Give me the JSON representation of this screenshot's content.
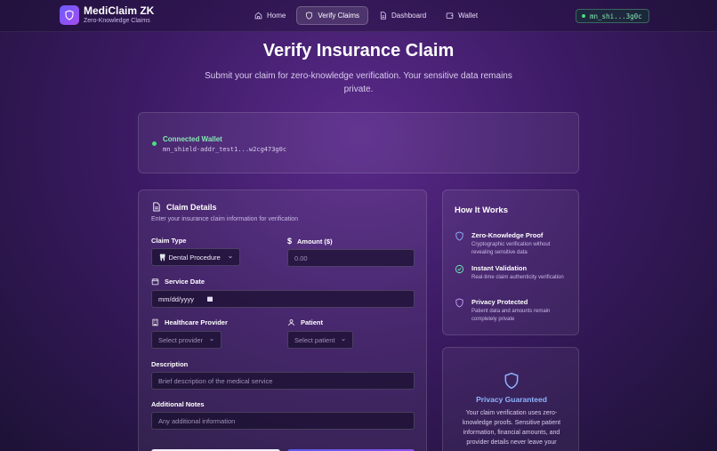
{
  "brand": {
    "title": "MediClaim ZK",
    "subtitle": "Zero-Knowledge Claims",
    "icon": "shield-icon"
  },
  "nav": {
    "items": [
      {
        "label": "Home",
        "icon": "home-icon",
        "active": false
      },
      {
        "label": "Verify Claims",
        "icon": "shield-icon",
        "active": true
      },
      {
        "label": "Dashboard",
        "icon": "document-icon",
        "active": false
      },
      {
        "label": "Wallet",
        "icon": "wallet-icon",
        "active": false
      }
    ],
    "wallet_short": "mn_shi...3g0c"
  },
  "hero": {
    "title": "Verify Insurance Claim",
    "subtitle": "Submit your claim for zero-knowledge verification. Your sensitive data remains private."
  },
  "connected": {
    "label": "Connected Wallet",
    "address": "mn_shield-addr_test1...w2cg473g0c"
  },
  "claim": {
    "title": "Claim Details",
    "subtitle": "Enter your insurance claim information for verification",
    "claim_type_label": "Claim Type",
    "claim_type_value": "Dental Procedure",
    "claim_type_icon": "tooth-icon",
    "amount_label": "Amount ($)",
    "amount_placeholder": "0.00",
    "date_label": "Service Date",
    "date_placeholder": "mm/dd/yyyy",
    "provider_label": "Healthcare Provider",
    "provider_placeholder": "Select provider",
    "patient_label": "Patient",
    "patient_placeholder": "Select patient",
    "description_label": "Description",
    "description_placeholder": "Brief description of the medical service",
    "notes_label": "Additional Notes",
    "notes_placeholder": "Any additional information"
  },
  "how": {
    "title": "How It Works",
    "steps": [
      {
        "title": "Zero-Knowledge Proof",
        "desc": "Cryptographic verification without revealing sensitive data",
        "icon": "shield-icon"
      },
      {
        "title": "Instant Validation",
        "desc": "Real-time claim authenticity verification",
        "icon": "check-circle-icon"
      },
      {
        "title": "Privacy Protected",
        "desc": "Patient data and amounts remain completely private",
        "icon": "shield-icon"
      }
    ]
  },
  "privacy": {
    "title": "Privacy Guaranteed",
    "desc": "Your claim verification uses zero-knowledge proofs. Sensitive patient information, financial amounts, and provider details never leave your"
  },
  "colors": {
    "accent": "#8a4ff0",
    "success": "#4ade80",
    "link_blue": "#8db4ff"
  }
}
